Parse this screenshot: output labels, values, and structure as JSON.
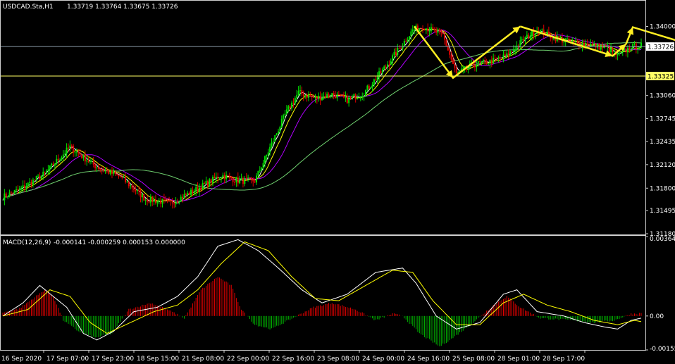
{
  "window": {
    "symbol_title": "USDCAD.Sta,H1",
    "ohlc": "1.33719 1.33764 1.33675 1.33726"
  },
  "macd_panel": {
    "title": "MACD(12,26,9)",
    "values": "-0.000141 -0.000259 0.000153 0.000000"
  },
  "colors": {
    "background": "#000000",
    "bull_candle": "#00e000",
    "bear_candle": "#e00000",
    "ma_fast": "#ffffff",
    "ma_mid": "#ffff00",
    "ma_slow": "#b000ff",
    "ma_long": "#6fd06f",
    "hline": "#ffff66",
    "arrow": "#ffee22",
    "macd_line": "#ffffff",
    "signal_line": "#ffff00",
    "hist_pos": "#e00000",
    "hist_neg": "#00b000",
    "axis_text": "#ffffff",
    "frame": "#cfcfcf"
  },
  "chart_data": [
    {
      "type": "candlestick",
      "title": "USDCAD.Sta,H1",
      "ylim": [
        1.3118,
        1.3434
      ],
      "y_ticks": [
        "1.34000",
        "1.33726",
        "1.33325",
        "1.33060",
        "1.32745",
        "1.32435",
        "1.32120",
        "1.31800",
        "1.31495",
        "1.31180"
      ],
      "y_tick_values": [
        1.34,
        1.33726,
        1.33325,
        1.3306,
        1.32745,
        1.32435,
        1.3212,
        1.318,
        1.31495,
        1.3118
      ],
      "x_labels": [
        "16 Sep 2020",
        "17 Sep 07:00",
        "17 Sep 23:00",
        "18 Sep 15:00",
        "21 Sep 08:00",
        "22 Sep 00:00",
        "22 Sep 16:00",
        "23 Sep 08:00",
        "24 Sep 00:00",
        "24 Sep 16:00",
        "25 Sep 08:00",
        "28 Sep 01:00",
        "28 Sep 17:00"
      ],
      "current_price": "1.33726",
      "level_price": "1.33325",
      "price_path": [
        [
          0,
          1.3168
        ],
        [
          10,
          1.3178
        ],
        [
          25,
          1.32
        ],
        [
          40,
          1.3236
        ],
        [
          55,
          1.321
        ],
        [
          70,
          1.3195
        ],
        [
          85,
          1.3165
        ],
        [
          100,
          1.316
        ],
        [
          115,
          1.3178
        ],
        [
          130,
          1.3198
        ],
        [
          140,
          1.319
        ],
        [
          150,
          1.319
        ],
        [
          158,
          1.323
        ],
        [
          168,
          1.328
        ],
        [
          176,
          1.331
        ],
        [
          186,
          1.3302
        ],
        [
          196,
          1.3308
        ],
        [
          205,
          1.33
        ],
        [
          215,
          1.331
        ],
        [
          226,
          1.334
        ],
        [
          236,
          1.337
        ],
        [
          244,
          1.3395
        ],
        [
          250,
          1.34
        ],
        [
          262,
          1.3388
        ],
        [
          270,
          1.3335
        ],
        [
          280,
          1.3348
        ],
        [
          290,
          1.3352
        ],
        [
          300,
          1.336
        ],
        [
          310,
          1.3382
        ],
        [
          318,
          1.3395
        ],
        [
          328,
          1.3385
        ],
        [
          338,
          1.3378
        ],
        [
          350,
          1.3375
        ],
        [
          360,
          1.337
        ],
        [
          366,
          1.336
        ],
        [
          374,
          1.3372
        ],
        [
          380,
          1.3374
        ]
      ],
      "moving_averages": [
        "ma_fast",
        "ma_mid",
        "ma_slow",
        "ma_long"
      ],
      "pattern_arrows": [
        [
          [
            245,
            1.34
          ],
          [
            268,
            1.333
          ],
          [
            308,
            1.34
          ]
        ],
        [
          [
            308,
            1.34
          ],
          [
            363,
            1.336
          ],
          [
            371,
            1.3376
          ]
        ],
        [
          [
            371,
            1.3376
          ],
          [
            375,
            1.3399
          ],
          [
            413,
            1.33726
          ]
        ],
        [
          [
            413,
            1.33726
          ],
          [
            428,
            1.3415
          ],
          [
            433,
            1.3433
          ]
        ]
      ]
    },
    {
      "type": "macd",
      "title": "MACD(12,26,9)",
      "ylim": [
        -0.001556,
        0.003642
      ],
      "y_ticks": [
        "0.003642",
        "0.00",
        "-0.001556"
      ],
      "y_tick_values": [
        0.003642,
        0.0,
        -0.001556
      ],
      "histogram": [
        [
          0,
          0.00015
        ],
        [
          10,
          0.00035
        ],
        [
          18,
          0.0008
        ],
        [
          25,
          0.0012
        ],
        [
          30,
          0.0009
        ],
        [
          36,
          -0.0002
        ],
        [
          45,
          -0.0007
        ],
        [
          55,
          -0.001
        ],
        [
          65,
          -0.0008
        ],
        [
          75,
          0.0003
        ],
        [
          88,
          0.0006
        ],
        [
          98,
          0.0003
        ],
        [
          108,
          -0.0001
        ],
        [
          118,
          0.0012
        ],
        [
          128,
          0.0018
        ],
        [
          136,
          0.0014
        ],
        [
          142,
          0.0003
        ],
        [
          150,
          -0.0004
        ],
        [
          160,
          -0.0006
        ],
        [
          170,
          -0.0002
        ],
        [
          185,
          0.0004
        ],
        [
          196,
          0.0006
        ],
        [
          210,
          0.0003
        ],
        [
          222,
          -0.0002
        ],
        [
          232,
          0.0001
        ],
        [
          238,
          0.0
        ],
        [
          248,
          -0.0008
        ],
        [
          260,
          -0.0014
        ],
        [
          268,
          -0.001
        ],
        [
          280,
          -0.0003
        ],
        [
          292,
          0.0005
        ],
        [
          300,
          0.0009
        ],
        [
          308,
          0.0004
        ],
        [
          320,
          -0.0001
        ],
        [
          340,
          -0.0002
        ],
        [
          352,
          -0.0003
        ],
        [
          364,
          -0.0002
        ],
        [
          374,
          0.0001
        ],
        [
          380,
          0.00012
        ]
      ],
      "macd_line": [
        [
          0,
          0.0
        ],
        [
          12,
          0.0006
        ],
        [
          22,
          0.0014
        ],
        [
          30,
          0.0009
        ],
        [
          38,
          0.0004
        ],
        [
          48,
          -0.0008
        ],
        [
          56,
          -0.0011
        ],
        [
          66,
          -0.0007
        ],
        [
          78,
          0.0002
        ],
        [
          92,
          0.0004
        ],
        [
          104,
          0.0009
        ],
        [
          116,
          0.0018
        ],
        [
          128,
          0.0032
        ],
        [
          140,
          0.0035
        ],
        [
          152,
          0.003
        ],
        [
          164,
          0.0022
        ],
        [
          178,
          0.0012
        ],
        [
          190,
          0.0006
        ],
        [
          205,
          0.001
        ],
        [
          222,
          0.002
        ],
        [
          238,
          0.0022
        ],
        [
          246,
          0.0015
        ],
        [
          258,
          0.0
        ],
        [
          270,
          -0.0006
        ],
        [
          284,
          -0.0003
        ],
        [
          298,
          0.001
        ],
        [
          306,
          0.0012
        ],
        [
          318,
          0.0002
        ],
        [
          334,
          0.0
        ],
        [
          346,
          -0.0003
        ],
        [
          358,
          -0.0005
        ],
        [
          366,
          -0.0006
        ],
        [
          374,
          -0.0002
        ],
        [
          380,
          -0.0001
        ]
      ],
      "signal_line": [
        [
          0,
          0.0
        ],
        [
          15,
          0.0003
        ],
        [
          28,
          0.0012
        ],
        [
          40,
          0.0009
        ],
        [
          52,
          -0.0003
        ],
        [
          62,
          -0.0008
        ],
        [
          76,
          -0.0003
        ],
        [
          90,
          0.0002
        ],
        [
          104,
          0.0005
        ],
        [
          116,
          0.0012
        ],
        [
          130,
          0.0024
        ],
        [
          144,
          0.0034
        ],
        [
          158,
          0.003
        ],
        [
          172,
          0.0018
        ],
        [
          186,
          0.0008
        ],
        [
          200,
          0.0007
        ],
        [
          216,
          0.0014
        ],
        [
          232,
          0.0021
        ],
        [
          244,
          0.002
        ],
        [
          256,
          0.0007
        ],
        [
          270,
          -0.0004
        ],
        [
          284,
          -0.0004
        ],
        [
          298,
          0.0006
        ],
        [
          310,
          0.001
        ],
        [
          324,
          0.0005
        ],
        [
          338,
          0.0002
        ],
        [
          352,
          -0.0002
        ],
        [
          366,
          -0.0004
        ],
        [
          376,
          -0.0002
        ],
        [
          380,
          -0.00026
        ]
      ]
    }
  ]
}
